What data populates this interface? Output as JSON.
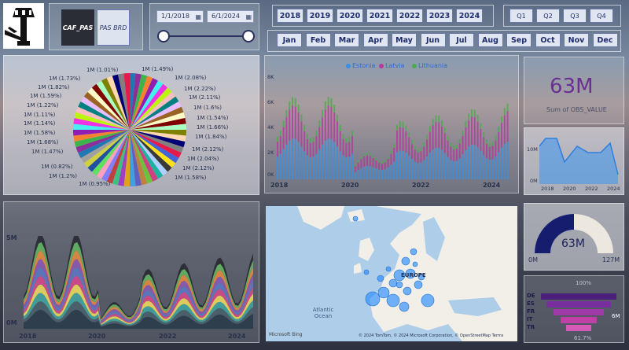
{
  "slicer": {
    "options": [
      "CAF_PAS",
      "PAS BRD"
    ],
    "selected": "CAF_PAS"
  },
  "date_range": {
    "start": "1/1/2018",
    "end": "6/1/2024"
  },
  "years": [
    "2018",
    "2019",
    "2020",
    "2021",
    "2022",
    "2023",
    "2024"
  ],
  "quarters": [
    "Q1",
    "Q2",
    "Q3",
    "Q4"
  ],
  "months": [
    "Jan",
    "Feb",
    "Mar",
    "Apr",
    "May",
    "Jun",
    "Jul",
    "Aug",
    "Sep",
    "Oct",
    "Nov",
    "Dec"
  ],
  "pie": {
    "left_labels": [
      "1M (1.01%)",
      "1M (1.73%)",
      "1M (1.82%)",
      "1M (1.59%)",
      "1M (1.22%)",
      "1M (1.11%)",
      "1M (1.14%)",
      "1M (1.58%)",
      "1M (1.68%)",
      "1M (1.47%)",
      "1M (0.82%)",
      "1M (1.2%)",
      "1M (0.95%)"
    ],
    "right_labels": [
      "1M (1.49%)",
      "1M (2.08%)",
      "1M (2.22%)",
      "1M (2.11%)",
      "1M (1.6%)",
      "1M (1.54%)",
      "1M (1.66%)",
      "1M (1.84%)",
      "1M (2.12%)",
      "1M (2.04%)",
      "1M (2.12%)",
      "1M (1.58%)"
    ]
  },
  "bar_chart": {
    "legend": [
      {
        "name": "Estonia",
        "color": "#3b8fe0"
      },
      {
        "name": "Latvia",
        "color": "#b33a9c"
      },
      {
        "name": "Lithuania",
        "color": "#4caa4c"
      }
    ],
    "y_ticks": [
      "8K",
      "6K",
      "4K",
      "2K",
      "0K"
    ],
    "x_ticks": [
      "2018",
      "2020",
      "2022",
      "2024"
    ]
  },
  "kpi": {
    "value": "63M",
    "caption": "Sum of OBS_VALUE"
  },
  "area_small": {
    "y_ticks": [
      "10M",
      "0M"
    ],
    "x_ticks": [
      "2018",
      "2020",
      "2022",
      "2024"
    ]
  },
  "stacked_area": {
    "y_ticks": [
      "5M",
      "0M"
    ],
    "x_ticks": [
      "2018",
      "2020",
      "2022",
      "2024"
    ]
  },
  "map": {
    "labels": {
      "europe": "EUROPE",
      "ocean": "Atlantic Ocean",
      "attribution": "© 2024 TomTom, © 2024 Microsoft Corporation, © OpenStreetMap Terms",
      "brand": "Microsoft Bing"
    }
  },
  "gauge": {
    "value": "63M",
    "min": "0M",
    "max": "127M",
    "fraction": 0.5
  },
  "funnel": {
    "top_label": "100%",
    "bottom_label": "61.7%",
    "value_label": "6M",
    "categories": [
      "DE",
      "ES",
      "FR",
      "IT",
      "TR"
    ]
  }
}
